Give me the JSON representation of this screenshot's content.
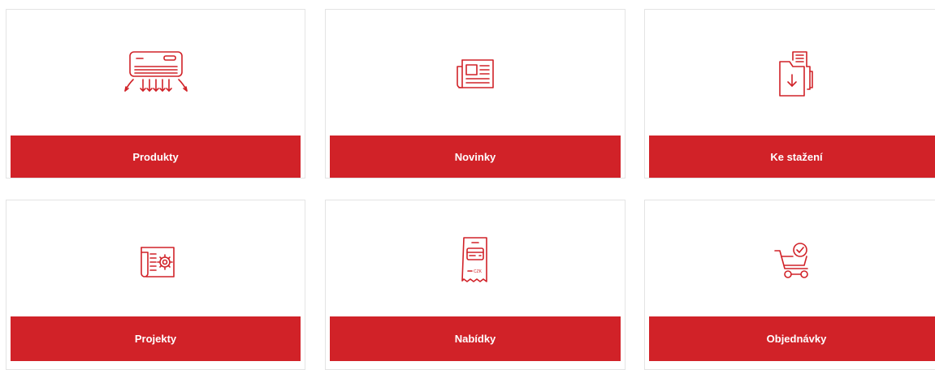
{
  "accent_color": "#d12228",
  "tiles": [
    {
      "label": "Produkty",
      "icon": "air-conditioner-icon"
    },
    {
      "label": "Novinky",
      "icon": "newspaper-icon"
    },
    {
      "label": "Ke stažení",
      "icon": "download-document-icon"
    },
    {
      "label": "Projekty",
      "icon": "project-settings-icon"
    },
    {
      "label": "Nabídky",
      "icon": "offer-receipt-icon"
    },
    {
      "label": "Objednávky",
      "icon": "cart-check-icon"
    }
  ],
  "receipt_currency": "CZK"
}
